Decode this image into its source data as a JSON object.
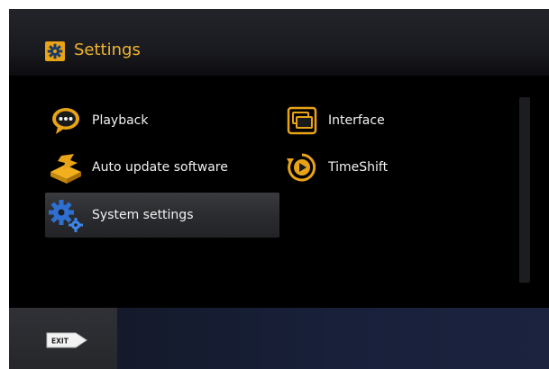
{
  "header": {
    "title": "Settings",
    "icon": "gear-icon"
  },
  "menu": {
    "left": [
      {
        "label": "Playback",
        "icon": "speech-bubble-icon",
        "selected": false
      },
      {
        "label": "Auto update software",
        "icon": "update-box-icon",
        "selected": false
      },
      {
        "label": "System settings",
        "icon": "gears-icon",
        "selected": true
      }
    ],
    "right": [
      {
        "label": "Interface",
        "icon": "interface-icon",
        "selected": false
      },
      {
        "label": "TimeShift",
        "icon": "timeshift-icon",
        "selected": false
      }
    ]
  },
  "footer": {
    "exit_label": "EXIT",
    "exit_icon": "exit-key-icon"
  },
  "colors": {
    "accent": "#e9a316",
    "title": "#f1b42f",
    "text": "#f2f2f2",
    "background": "#000000"
  }
}
